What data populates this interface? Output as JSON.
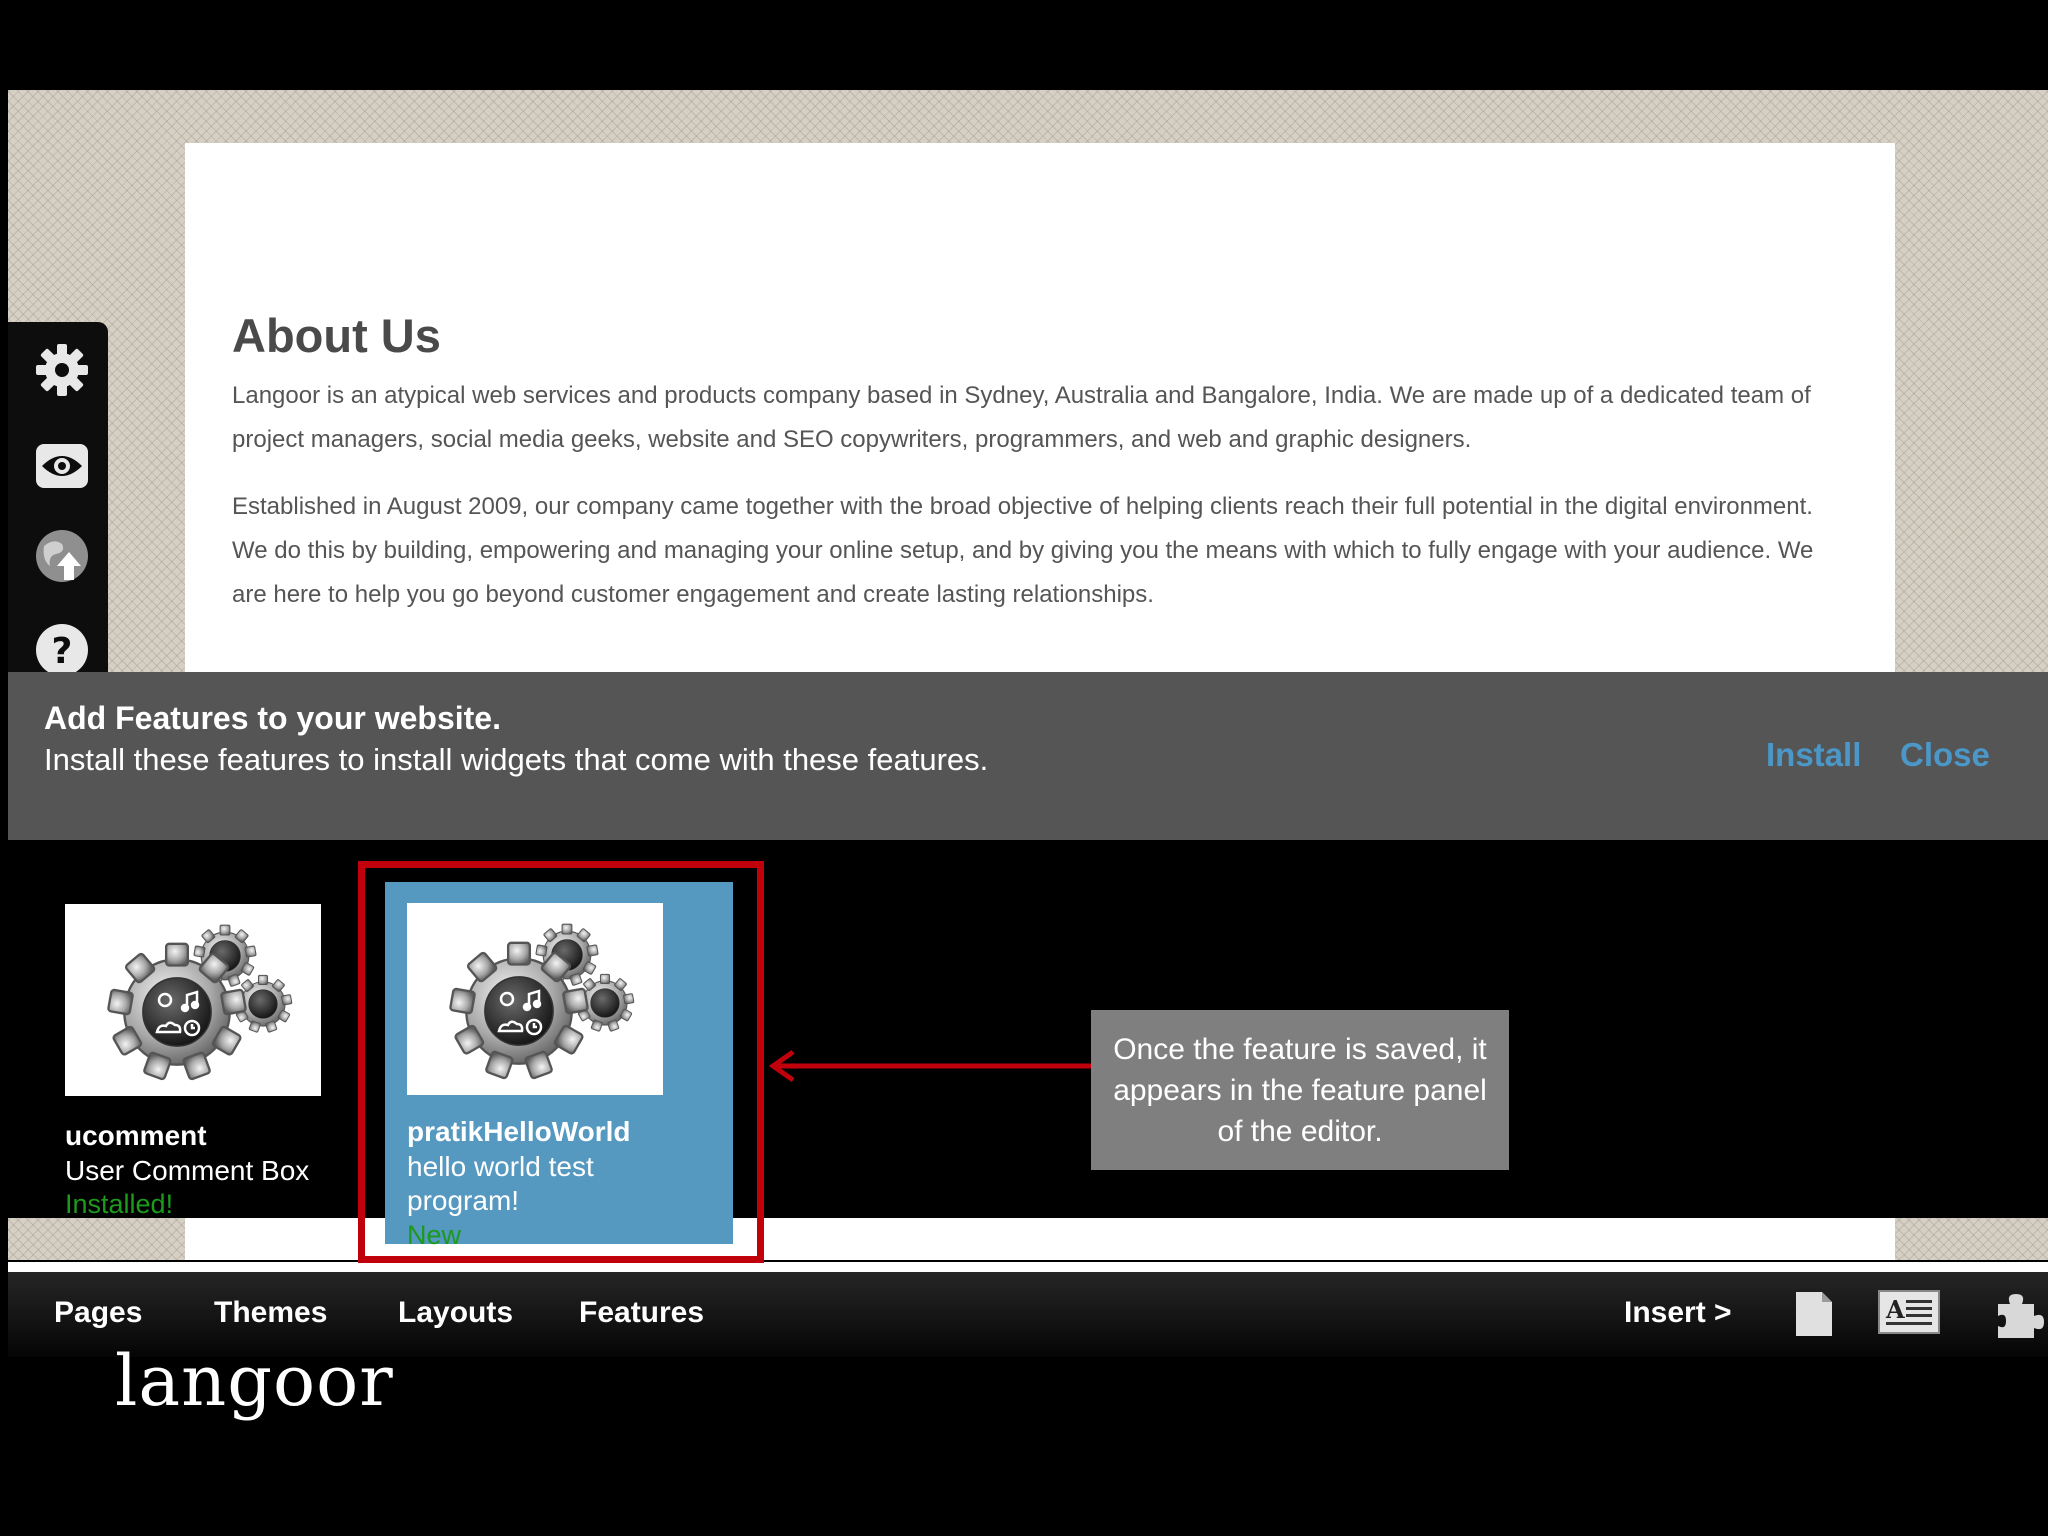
{
  "page": {
    "heading": "About Us",
    "paragraphs": [
      "Langoor is an atypical web services and products company based in Sydney, Australia and Bangalore, India. We are made up of a dedicated team of project managers, social media geeks, website and SEO copywriters, programmers, and web and graphic designers.",
      "Established in August 2009, our company came together with the broad objective of helping clients reach their full potential in the digital environment. We do this by building, empowering and managing your online setup, and by giving you the means with which to fully engage with your audience. We are here to help you go beyond customer engagement and create lasting relationships."
    ]
  },
  "left_toolbar": {
    "icons": [
      "gear-icon",
      "eye-icon",
      "globe-upload-icon",
      "help-icon"
    ]
  },
  "features_banner": {
    "title": "Add Features to your website.",
    "subtitle": "Install these features to install widgets that come with these features.",
    "install_label": "Install",
    "close_label": "Close",
    "link_color": "#4b97c8"
  },
  "features": [
    {
      "name": "ucomment",
      "description": "User Comment Box",
      "status": "Installed!",
      "icon": "gears-icon"
    },
    {
      "name": "pratikHelloWorld",
      "description": "hello world test program!",
      "status": "New",
      "icon": "gears-icon",
      "selected": true,
      "highlight_color": "#5598c0"
    }
  ],
  "bottom_nav": {
    "items": [
      "Pages",
      "Themes",
      "Layouts",
      "Features"
    ],
    "insert_label": "Insert >",
    "icons": [
      "page-icon",
      "text-block-icon",
      "puzzle-icon"
    ]
  },
  "logo": {
    "text": "langoor"
  },
  "annotation": {
    "callout_text": "Once the feature is saved, it appears in the feature panel of the editor.",
    "frame_color": "#c0000b"
  },
  "status_color": "#1c9a1c"
}
